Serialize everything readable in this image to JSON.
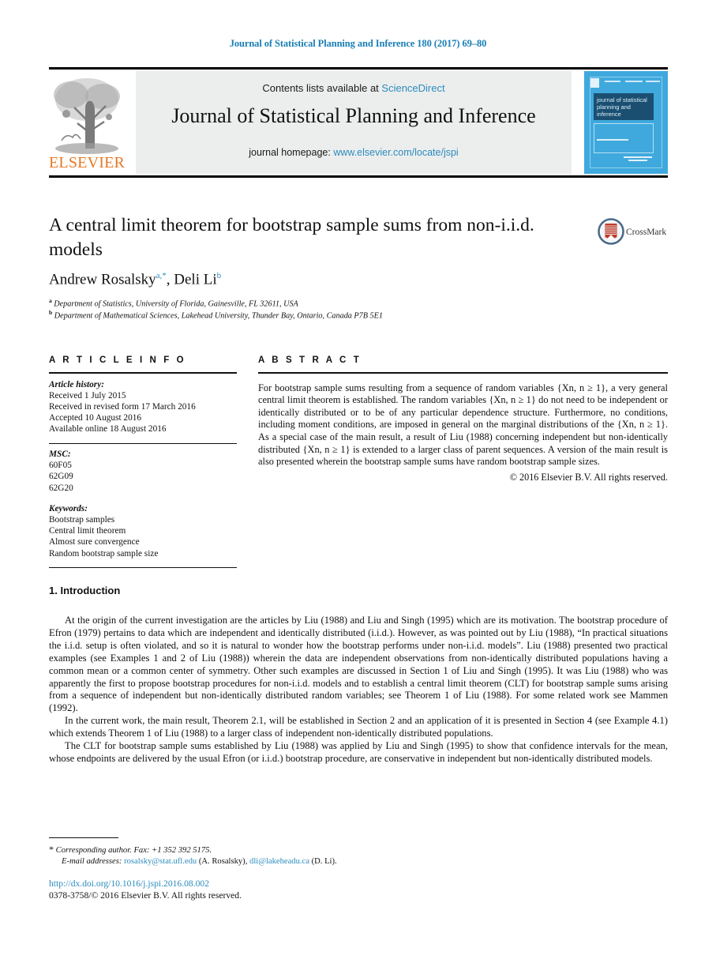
{
  "running_head": "Journal of Statistical Planning and Inference 180 (2017) 69–80",
  "masthead": {
    "contents_prefix": "Contents lists available at ",
    "sciencedirect": "ScienceDirect",
    "journal_title": "Journal of Statistical Planning and Inference",
    "homepage_prefix": "journal homepage: ",
    "homepage_url": "www.elsevier.com/locate/jspi",
    "publisher_wordmark": "ELSEVIER",
    "cover_title": "journal of statistical planning and inference"
  },
  "article": {
    "title": "A central limit theorem for bootstrap sample sums from non-i.i.d. models",
    "authors_plain": "Andrew Rosalsky",
    "author1": "Andrew Rosalsky",
    "author1_sup": "a,*",
    "author2": "Deli Li",
    "author2_sup": "b",
    "affiliation_a_marker": "a",
    "affiliation_a": "Department of Statistics, University of Florida, Gainesville, FL 32611, USA",
    "affiliation_b_marker": "b",
    "affiliation_b": "Department of Mathematical Sciences, Lakehead University, Thunder Bay, Ontario, Canada P7B 5E1",
    "crossmark_label": "CrossMark"
  },
  "info": {
    "heading": "A R T I C L E   I N F O",
    "history_label": "Article history:",
    "history": [
      "Received 1 July 2015",
      "Received in revised form 17 March 2016",
      "Accepted 10 August 2016",
      "Available online 18 August 2016"
    ],
    "msc_label": "MSC:",
    "msc": [
      "60F05",
      "62G09",
      "62G20"
    ],
    "keywords_label": "Keywords:",
    "keywords": [
      "Bootstrap samples",
      "Central limit theorem",
      "Almost sure convergence",
      "Random bootstrap sample size"
    ]
  },
  "abstract": {
    "heading": "A B S T R A C T",
    "text": "For bootstrap sample sums resulting from a sequence of random variables {Xn, n ≥ 1}, a very general central limit theorem is established. The random variables {Xn, n ≥ 1} do not need to be independent or identically distributed or to be of any particular dependence structure. Furthermore, no conditions, including moment conditions, are imposed in general on the marginal distributions of the {Xn, n ≥ 1}. As a special case of the main result, a result of Liu (1988) concerning independent but non-identically distributed {Xn, n ≥ 1} is extended to a larger class of parent sequences. A version of the main result is also presented wherein the bootstrap sample sums have random bootstrap sample sizes.",
    "copyright": "© 2016 Elsevier B.V. All rights reserved."
  },
  "body": {
    "section_title": "1. Introduction",
    "para1": "At the origin of the current investigation are the articles by Liu (1988) and Liu and Singh (1995) which are its motivation. The bootstrap procedure of Efron (1979) pertains to data which are independent and identically distributed (i.i.d.). However, as was pointed out by Liu (1988), “In practical situations the i.i.d. setup is often violated, and so it is natural to wonder how the bootstrap performs under non-i.i.d. models”. Liu (1988) presented two practical examples (see Examples 1 and 2 of Liu (1988)) wherein the data are independent observations from non-identically distributed populations having a common mean or a common center of symmetry. Other such examples are discussed in Section 1 of Liu and Singh (1995). It was Liu (1988) who was apparently the first to propose bootstrap procedures for non-i.i.d. models and to establish a central limit theorem (CLT) for bootstrap sample sums arising from a sequence of independent but non-identically distributed random variables; see Theorem 1 of Liu (1988). For some related work see Mammen (1992).",
    "para2": "In the current work, the main result, Theorem 2.1, will be established in Section 2 and an application of it is presented in Section 4 (see Example 4.1) which extends Theorem 1 of Liu (1988) to a larger class of independent non-identically distributed populations.",
    "para3": "The CLT for bootstrap sample sums established by Liu (1988) was applied by Liu and Singh (1995) to show that confidence intervals for the mean, whose endpoints are delivered by the usual Efron (or i.i.d.) bootstrap procedure, are conservative in independent but non-identically distributed models."
  },
  "footer": {
    "corresponding": "Corresponding author. Fax: +1 352 392 5175.",
    "email_label": "E-mail addresses:",
    "email1": "rosalsky@stat.ufl.edu",
    "email1_owner": "(A. Rosalsky),",
    "email2": "dli@lakeheadu.ca",
    "email2_owner": "(D. Li).",
    "doi": "http://dx.doi.org/10.1016/j.jspi.2016.08.002",
    "issn": "0378-3758/© 2016 Elsevier B.V. All rights reserved."
  },
  "colors": {
    "link": "#2b8cbe",
    "runhead": "#1a7fb5",
    "elsevier_orange": "#e87722",
    "cover_blue": "#3fa9dd",
    "cover_navy": "#1b4f72"
  }
}
